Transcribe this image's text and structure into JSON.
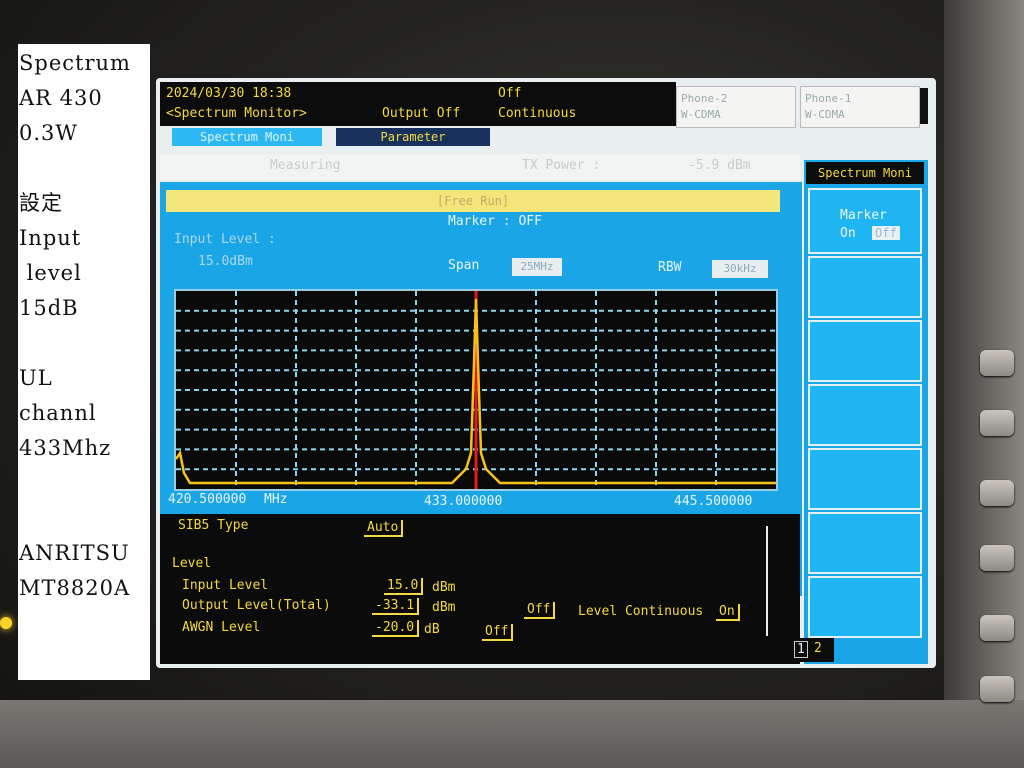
{
  "note": {
    "lines": [
      "Spectrum",
      "AR 430",
      "0.3W",
      "設定",
      "Input",
      " level",
      "15dB",
      "UL",
      "channl",
      "433Mhz",
      "ANRITSU",
      "MT8820A"
    ]
  },
  "screen": {
    "datetime": "2024/03/30 18:38",
    "mode": "<Spectrum Monitor>",
    "output": "Output Off",
    "off_status": "Off",
    "continuous": "Continuous",
    "phone2": {
      "name": "Phone-2",
      "system": "W-CDMA"
    },
    "phone1": {
      "name": "Phone-1",
      "system": "W-CDMA"
    },
    "tabs": [
      {
        "label": "Spectrum Moni"
      },
      {
        "label": "Parameter"
      }
    ],
    "status": {
      "measuring": "Measuring",
      "tx_power_label": "TX Power :",
      "tx_power_value": "-5.9 dBm"
    },
    "banner": "[Free Run]",
    "marker": "Marker : OFF",
    "input_level_label": "Input Level :",
    "input_level_value": "15.0dBm",
    "span_label": "Span",
    "span_value": "25MHz",
    "rbw_label": "RBW",
    "rbw_value": "30kHz",
    "x_start": "420.500000",
    "x_unit": "MHz",
    "x_center": "433.000000",
    "x_stop": "445.500000",
    "params": {
      "sib5_label": "SIB5 Type",
      "sib5_value": "Auto",
      "level_header": "Level",
      "input_level_label": "Input Level",
      "input_level_value": "15.0",
      "input_level_unit": "dBm",
      "output_level_label": "Output Level(Total)",
      "output_level_value": "-33.1",
      "output_level_unit": "dBm",
      "output_off": "Off",
      "level_cont_label": "Level Continuous",
      "level_cont_value": "On",
      "awgn_label": "AWGN Level",
      "awgn_value": "-20.0",
      "awgn_unit": "dB",
      "awgn_off": "Off"
    },
    "softkeys": {
      "title": "Spectrum Moni",
      "marker_label": "Marker",
      "marker_on": "On",
      "marker_off": "Off"
    },
    "pages": [
      "1",
      "2"
    ]
  },
  "chart_data": {
    "type": "line",
    "title": "",
    "x_start_mhz": 420.5,
    "x_center_mhz": 433.0,
    "x_stop_mhz": 445.5,
    "span_mhz": 25,
    "peak_x_mhz": 433.0,
    "grid": true,
    "colors": {
      "trace": "#f6c21a",
      "marker_line": "#e21c1c",
      "grid": "#8fd4ee"
    }
  }
}
